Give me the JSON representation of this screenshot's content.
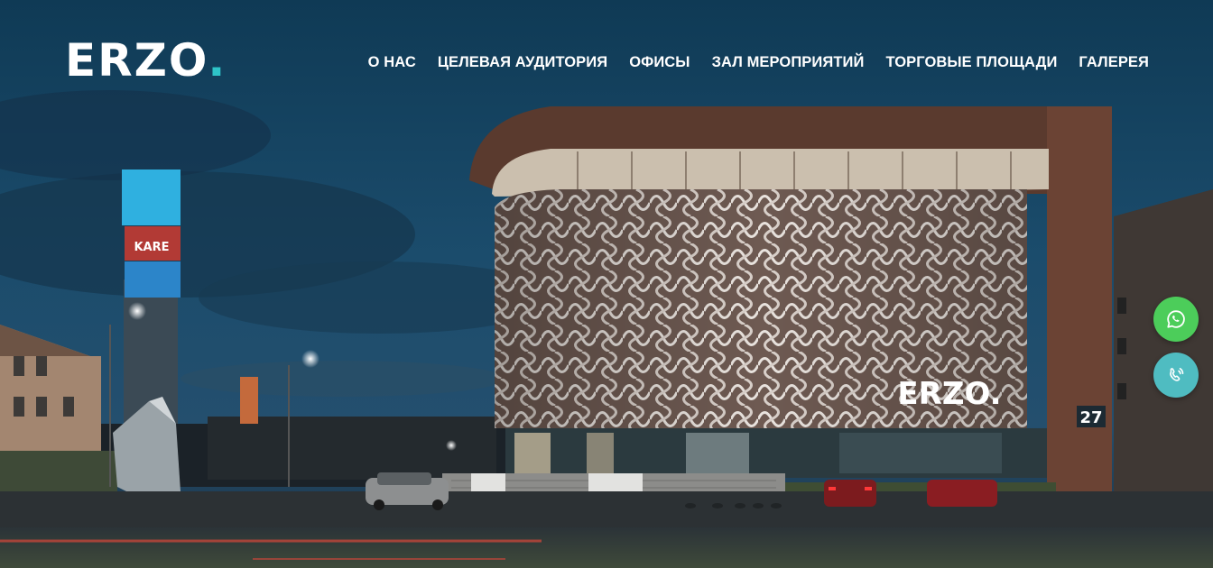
{
  "header": {
    "logo_text": "ERZO",
    "logo_dot": "."
  },
  "nav": {
    "items": [
      {
        "label": "О НАС"
      },
      {
        "label": "ЦЕЛЕВАЯ АУДИТОРИЯ"
      },
      {
        "label": "ОФИСЫ"
      },
      {
        "label": "ЗАЛ МЕРОПРИЯТИЙ"
      },
      {
        "label": "ТОРГОВЫЕ ПЛОЩАДИ"
      },
      {
        "label": "ГАЛЕРЕЯ"
      }
    ]
  },
  "hero": {
    "building_sign": "ERZO.",
    "building_number": "27",
    "billboard_text": "KARE"
  },
  "floating": {
    "whatsapp_icon": "whatsapp-icon",
    "call_icon": "call-icon"
  },
  "colors": {
    "accent": "#2ec4c8",
    "whatsapp": "#4ccd5a",
    "call": "#4fbcc1"
  }
}
